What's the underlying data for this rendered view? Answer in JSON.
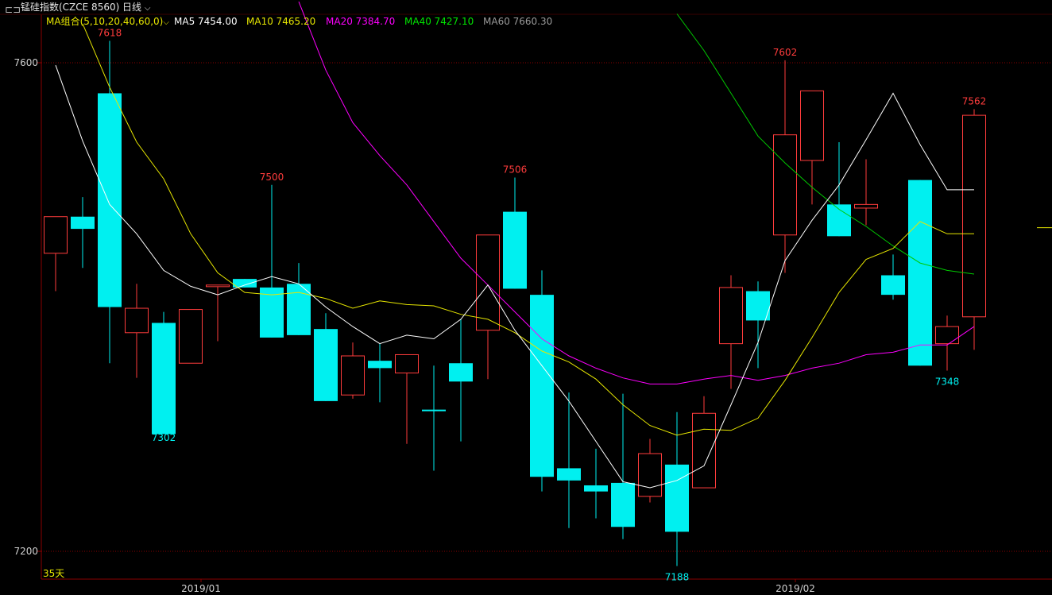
{
  "header": {
    "window_icon": "window-restore-icon",
    "title": "锰硅指数(CZCE 8560)",
    "period": "日线",
    "period_dropdown_icon": "chevron-down-icon"
  },
  "ma_legend": {
    "group": {
      "label": "MA组合(5,10,20,40,60,0)",
      "color": "#e6e600"
    },
    "items": [
      {
        "label": "MA5 7454.00",
        "color": "#ffffff"
      },
      {
        "label": "MA10 7465.20",
        "color": "#e6e600"
      },
      {
        "label": "MA20 7384.70",
        "color": "#ff00ff"
      },
      {
        "label": "MA40 7427.10",
        "color": "#00e600"
      },
      {
        "label": "MA60 7660.30",
        "color": "#9a9a9a"
      }
    ]
  },
  "colors": {
    "up": "#ff3c3c",
    "down": "#00f0f0",
    "grid": "#8a0000",
    "axis": "#8a0000",
    "text": "#d0d0d0"
  },
  "days_label": "35天",
  "chart_data": {
    "type": "candlestick",
    "ylim": [
      7191,
      7652
    ],
    "y_ticks": [
      7200,
      7600
    ],
    "x_labels": [
      {
        "index": 5,
        "label": "2019/01"
      },
      {
        "index": 27,
        "label": "2019/02"
      }
    ],
    "candles": [
      {
        "o": 7444,
        "h": 7466,
        "l": 7413,
        "c": 7474,
        "t": "up"
      },
      {
        "o": 7474,
        "h": 7490,
        "l": 7432,
        "c": 7464,
        "t": "down"
      },
      {
        "o": 7575,
        "h": 7618,
        "l": 7354,
        "c": 7400,
        "t": "down"
      },
      {
        "o": 7379,
        "h": 7419,
        "l": 7342,
        "c": 7399,
        "t": "up"
      },
      {
        "o": 7387,
        "h": 7396,
        "l": 7301,
        "c": 7296,
        "t": "down"
      },
      {
        "o": 7354,
        "h": 7388,
        "l": 7370,
        "c": 7398,
        "t": "up"
      },
      {
        "o": 7418,
        "h": 7410,
        "l": 7372,
        "c": 7417,
        "t": "up"
      },
      {
        "o": 7423,
        "h": 7404,
        "l": 7441,
        "c": 7416,
        "t": "down"
      },
      {
        "o": 7416,
        "h": 7500,
        "l": 7381,
        "c": 7375,
        "t": "down"
      },
      {
        "o": 7419,
        "h": 7436,
        "l": 7395,
        "c": 7377,
        "t": "down"
      },
      {
        "o": 7382,
        "h": 7395,
        "l": 7346,
        "c": 7323,
        "t": "down"
      },
      {
        "o": 7360,
        "h": 7371,
        "l": 7325,
        "c": 7328,
        "t": "up"
      },
      {
        "o": 7356,
        "h": 7370,
        "l": 7322,
        "c": 7350,
        "t": "down"
      },
      {
        "o": 7346,
        "h": 7358,
        "l": 7288,
        "c": 7361,
        "t": "up"
      },
      {
        "o": 7316,
        "h": 7352,
        "l": 7266,
        "c": 7316,
        "t": "down"
      },
      {
        "o": 7354,
        "h": 7390,
        "l": 7290,
        "c": 7339,
        "t": "down"
      },
      {
        "o": 7381,
        "h": 7446,
        "l": 7341,
        "c": 7459,
        "t": "up"
      },
      {
        "o": 7478,
        "h": 7506,
        "l": 7454,
        "c": 7415,
        "t": "down"
      },
      {
        "o": 7410,
        "h": 7430,
        "l": 7249,
        "c": 7261,
        "t": "down"
      },
      {
        "o": 7268,
        "h": 7330,
        "l": 7219,
        "c": 7258,
        "t": "down"
      },
      {
        "o": 7254,
        "h": 7284,
        "l": 7227,
        "c": 7249,
        "t": "down"
      },
      {
        "o": 7256,
        "h": 7329,
        "l": 7210,
        "c": 7220,
        "t": "down"
      },
      {
        "o": 7280,
        "h": 7292,
        "l": 7240,
        "c": 7245,
        "t": "up"
      },
      {
        "o": 7271,
        "h": 7314,
        "l": 7188,
        "c": 7216,
        "t": "down"
      },
      {
        "o": 7313,
        "h": 7327,
        "l": 7260,
        "c": 7252,
        "t": "up"
      },
      {
        "o": 7416,
        "h": 7426,
        "l": 7333,
        "c": 7370,
        "t": "up"
      },
      {
        "o": 7413,
        "h": 7421,
        "l": 7350,
        "c": 7389,
        "t": "down"
      },
      {
        "o": 7459,
        "h": 7602,
        "l": 7428,
        "c": 7541,
        "t": "up"
      },
      {
        "o": 7520,
        "h": 7573,
        "l": 7484,
        "c": 7577,
        "t": "up"
      },
      {
        "o": 7484,
        "h": 7535,
        "l": 7464,
        "c": 7458,
        "t": "down"
      },
      {
        "o": 7484,
        "h": 7521,
        "l": 7467,
        "c": 7481,
        "t": "up"
      },
      {
        "o": 7426,
        "h": 7443,
        "l": 7406,
        "c": 7410,
        "t": "down"
      },
      {
        "o": 7504,
        "h": 7495,
        "l": 7352,
        "c": 7352,
        "t": "down"
      },
      {
        "o": 7384,
        "h": 7393,
        "l": 7348,
        "c": 7370,
        "t": "up"
      },
      {
        "o": 7392,
        "h": 7562,
        "l": 7365,
        "c": 7557,
        "t": "up"
      }
    ],
    "ma5": [
      7598,
      7536,
      7484,
      7460,
      7430,
      7417,
      7410,
      7418,
      7425,
      7419,
      7400,
      7384,
      7370,
      7377,
      7374,
      7390,
      7418,
      7381,
      7352,
      7323,
      7290,
      7257,
      7252,
      7258,
      7270,
      7320,
      7371,
      7438,
      7471,
      7500,
      7537,
      7575,
      7533,
      7496,
      7496
    ],
    "ma10": [
      null,
      7632,
      7580,
      7535,
      7505,
      7460,
      7428,
      7412,
      7410,
      7412,
      7407,
      7399,
      7405,
      7402,
      7401,
      7394,
      7390,
      7379,
      7364,
      7355,
      7341,
      7320,
      7303,
      7295,
      7300,
      7299,
      7309,
      7340,
      7375,
      7412,
      7439,
      7448,
      7470,
      7460,
      7460
    ],
    "ma20": [
      null,
      null,
      null,
      null,
      null,
      null,
      null,
      null,
      null,
      7650,
      7594,
      7551,
      7524,
      7500,
      7470,
      7440,
      7418,
      7396,
      7374,
      7360,
      7350,
      7342,
      7337,
      7337,
      7341,
      7344,
      7340,
      7344,
      7350,
      7354,
      7361,
      7363,
      7369,
      7369,
      7384
    ],
    "ma40": [
      null,
      null,
      null,
      null,
      null,
      null,
      null,
      null,
      null,
      null,
      null,
      null,
      null,
      null,
      null,
      null,
      null,
      null,
      null,
      null,
      null,
      null,
      null,
      7640,
      7610,
      7575,
      7540,
      7518,
      7498,
      7480,
      7466,
      7450,
      7436,
      7430,
      7427
    ],
    "label_high": [
      {
        "index": 2,
        "value": 7618,
        "text": "7618"
      },
      {
        "index": 8,
        "value": 7500,
        "text": "7500"
      },
      {
        "index": 17,
        "value": 7506,
        "text": "7506"
      },
      {
        "index": 27,
        "value": 7602,
        "text": "7602"
      },
      {
        "index": 34,
        "value": 7562,
        "text": "7562"
      }
    ],
    "label_low": [
      {
        "index": 4,
        "value": 7302,
        "text": "7302"
      },
      {
        "index": 23,
        "value": 7188,
        "text": "7188"
      },
      {
        "index": 33,
        "value": 7348,
        "text": "7348"
      }
    ]
  }
}
